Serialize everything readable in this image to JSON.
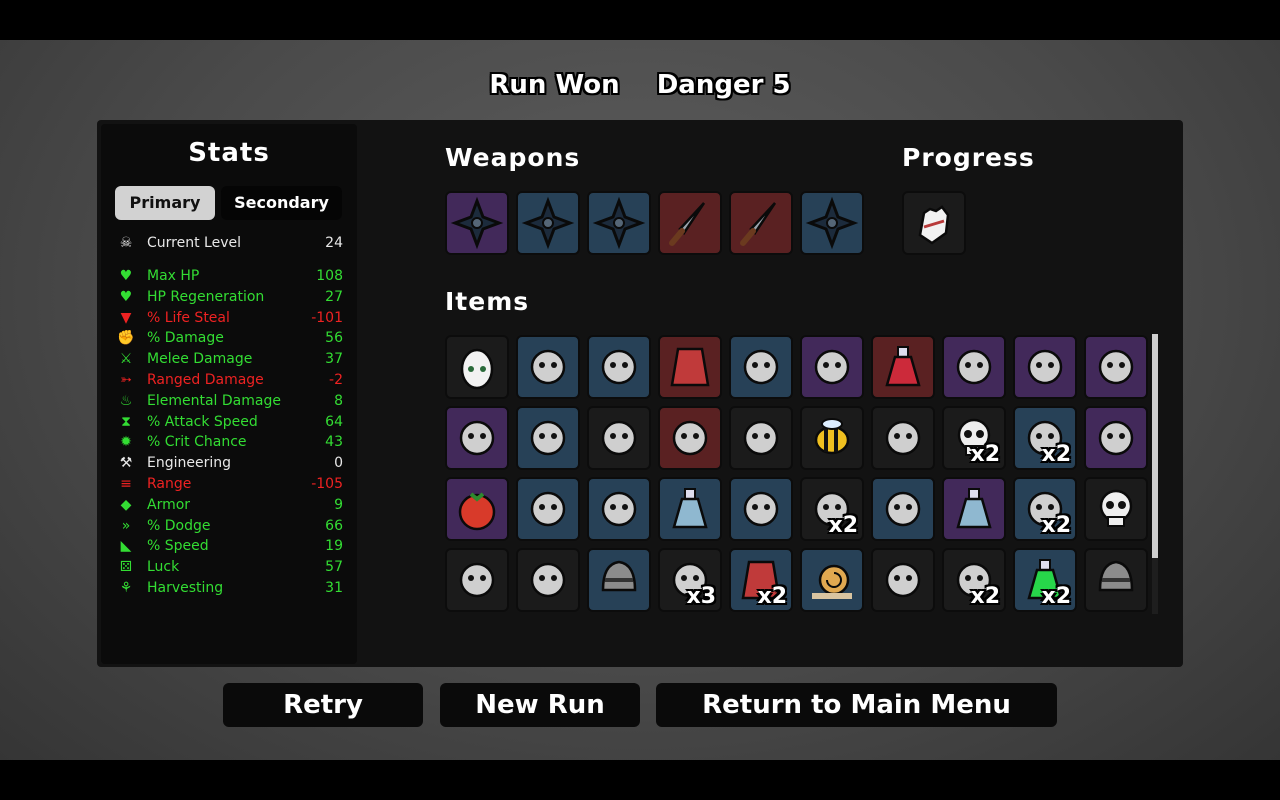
{
  "header": {
    "result": "Run Won",
    "danger": "Danger 5"
  },
  "stats": {
    "title": "Stats",
    "tabs": {
      "primary": "Primary",
      "secondary": "Secondary",
      "active": "primary"
    },
    "current_level": {
      "label": "Current Level",
      "value": "24",
      "icon": "level-skull-icon",
      "color": "#e8e8e8"
    },
    "rows": [
      {
        "label": "Max HP",
        "value": "108",
        "color": "#33dd33",
        "icon": "heart-icon"
      },
      {
        "label": "HP Regeneration",
        "value": "27",
        "color": "#33dd33",
        "icon": "heart-plus-icon"
      },
      {
        "label": "% Life Steal",
        "value": "-101",
        "color": "#ee2222",
        "icon": "fangs-icon"
      },
      {
        "label": "% Damage",
        "value": "56",
        "color": "#33dd33",
        "icon": "fist-icon"
      },
      {
        "label": "Melee Damage",
        "value": "37",
        "color": "#33dd33",
        "icon": "sword-icon"
      },
      {
        "label": "Ranged Damage",
        "value": "-2",
        "color": "#ee2222",
        "icon": "bow-icon"
      },
      {
        "label": "Elemental Damage",
        "value": "8",
        "color": "#33dd33",
        "icon": "flame-icon"
      },
      {
        "label": "% Attack Speed",
        "value": "64",
        "color": "#33dd33",
        "icon": "hourglass-icon"
      },
      {
        "label": "% Crit Chance",
        "value": "43",
        "color": "#33dd33",
        "icon": "crit-burst-icon"
      },
      {
        "label": "Engineering",
        "value": "0",
        "color": "#e8e8e8",
        "icon": "wrench-icon"
      },
      {
        "label": "Range",
        "value": "-105",
        "color": "#ee2222",
        "icon": "range-waves-icon"
      },
      {
        "label": "Armor",
        "value": "9",
        "color": "#33dd33",
        "icon": "shield-icon"
      },
      {
        "label": "% Dodge",
        "value": "66",
        "color": "#33dd33",
        "icon": "dodge-icon"
      },
      {
        "label": "% Speed",
        "value": "19",
        "color": "#33dd33",
        "icon": "boot-icon"
      },
      {
        "label": "Luck",
        "value": "57",
        "color": "#33dd33",
        "icon": "dice-icon"
      },
      {
        "label": "Harvesting",
        "value": "31",
        "color": "#33dd33",
        "icon": "wheat-icon"
      }
    ]
  },
  "weapons": {
    "title": "Weapons",
    "items": [
      {
        "name": "shuriken-icon",
        "tier": "purple"
      },
      {
        "name": "shuriken-icon",
        "tier": "blue"
      },
      {
        "name": "shuriken-icon",
        "tier": "blue"
      },
      {
        "name": "knife-icon",
        "tier": "red"
      },
      {
        "name": "knife-icon",
        "tier": "red"
      },
      {
        "name": "shuriken-icon",
        "tier": "blue"
      }
    ]
  },
  "progress": {
    "title": "Progress",
    "items": [
      {
        "name": "white-glove-icon",
        "tier": "dark"
      }
    ]
  },
  "items": {
    "title": "Items",
    "rows": [
      [
        {
          "name": "egg-icon",
          "tier": "dark",
          "qty": ""
        },
        {
          "name": "scarf-icon",
          "tier": "blue",
          "qty": ""
        },
        {
          "name": "lightning-icon",
          "tier": "blue",
          "qty": ""
        },
        {
          "name": "cape-icon",
          "tier": "red",
          "qty": ""
        },
        {
          "name": "worm-icon",
          "tier": "blue",
          "qty": ""
        },
        {
          "name": "ghost-blob-icon",
          "tier": "purple",
          "qty": ""
        },
        {
          "name": "test-tube-icon",
          "tier": "red",
          "qty": ""
        },
        {
          "name": "zombie-head-icon",
          "tier": "purple",
          "qty": ""
        },
        {
          "name": "alchemy-set-icon",
          "tier": "purple",
          "qty": ""
        },
        {
          "name": "fairy-frog-icon",
          "tier": "purple",
          "qty": ""
        }
      ],
      [
        {
          "name": "robot-legs-icon",
          "tier": "purple",
          "qty": ""
        },
        {
          "name": "tentacle-icon",
          "tier": "blue",
          "qty": ""
        },
        {
          "name": "snake-icon",
          "tier": "dark",
          "qty": ""
        },
        {
          "name": "gnome-icon",
          "tier": "red",
          "qty": ""
        },
        {
          "name": "spirit-snake-icon",
          "tier": "dark",
          "qty": ""
        },
        {
          "name": "bee-icon",
          "tier": "dark",
          "qty": ""
        },
        {
          "name": "syringe-icon",
          "tier": "dark",
          "qty": ""
        },
        {
          "name": "skull-icon",
          "tier": "dark",
          "qty": "x2"
        },
        {
          "name": "horseshoe-icon",
          "tier": "blue",
          "qty": "x2"
        },
        {
          "name": "brain-icon",
          "tier": "purple",
          "qty": ""
        }
      ],
      [
        {
          "name": "tomato-icon",
          "tier": "purple",
          "qty": ""
        },
        {
          "name": "bullet-icon",
          "tier": "blue",
          "qty": ""
        },
        {
          "name": "bunny-icon",
          "tier": "blue",
          "qty": ""
        },
        {
          "name": "potion-flask-icon",
          "tier": "blue",
          "qty": ""
        },
        {
          "name": "garden-icon",
          "tier": "blue",
          "qty": ""
        },
        {
          "name": "hedgehog-icon",
          "tier": "dark",
          "qty": "x2"
        },
        {
          "name": "turret-icon",
          "tier": "blue",
          "qty": ""
        },
        {
          "name": "baby-bottle-icon",
          "tier": "purple",
          "qty": ""
        },
        {
          "name": "claw-icon",
          "tier": "blue",
          "qty": "x2"
        },
        {
          "name": "skull-pile-icon",
          "tier": "dark",
          "qty": ""
        }
      ],
      [
        {
          "name": "bacon-icon",
          "tier": "dark",
          "qty": ""
        },
        {
          "name": "bandaged-head-icon",
          "tier": "dark",
          "qty": ""
        },
        {
          "name": "helmet-face-icon",
          "tier": "blue",
          "qty": ""
        },
        {
          "name": "boxing-glove-icon",
          "tier": "dark",
          "qty": "x3"
        },
        {
          "name": "banner-icon",
          "tier": "blue",
          "qty": "x2"
        },
        {
          "name": "snail-icon",
          "tier": "blue",
          "qty": ""
        },
        {
          "name": "monkey-icon",
          "tier": "dark",
          "qty": ""
        },
        {
          "name": "lamp-icon",
          "tier": "dark",
          "qty": "x2"
        },
        {
          "name": "green-potion-icon",
          "tier": "blue",
          "qty": "x2"
        },
        {
          "name": "knight-helmet-icon",
          "tier": "dark",
          "qty": ""
        }
      ]
    ],
    "scroll_fraction": 0.8
  },
  "buttons": {
    "retry": "Retry",
    "new_run": "New Run",
    "main_menu": "Return to Main Menu"
  }
}
